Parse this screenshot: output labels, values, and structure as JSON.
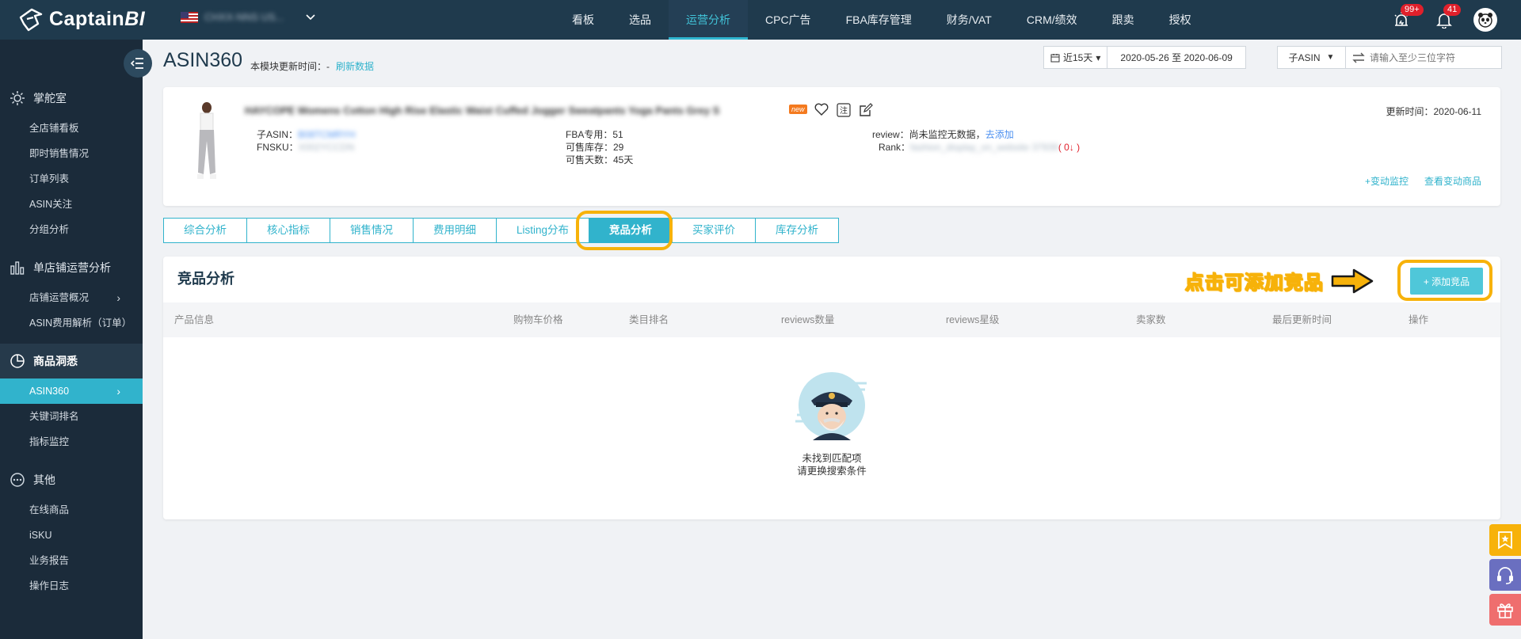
{
  "brand": {
    "name_main": "Captain",
    "name_bi": "BI"
  },
  "store": {
    "name": "CHXX-NNS US..."
  },
  "nav": [
    {
      "label": "看板",
      "active": false
    },
    {
      "label": "选品",
      "active": false
    },
    {
      "label": "运营分析",
      "active": true
    },
    {
      "label": "CPC广告",
      "active": false
    },
    {
      "label": "FBA库存管理",
      "active": false
    },
    {
      "label": "财务/VAT",
      "active": false
    },
    {
      "label": "CRM/绩效",
      "active": false
    },
    {
      "label": "跟卖",
      "active": false
    },
    {
      "label": "授权",
      "active": false
    }
  ],
  "top_icons": {
    "alert_badge": "99+",
    "notify_badge": "41"
  },
  "sidebar": {
    "groups": [
      {
        "label": "掌舵室",
        "icon": "gear-icon",
        "items": [
          "全店铺看板",
          "即时销售情况",
          "订单列表",
          "ASIN关注",
          "分组分析"
        ]
      },
      {
        "label": "单店铺运营分析",
        "icon": "bar-chart-icon",
        "items": [
          "店铺运营概况",
          "ASIN费用解析（订单）"
        ]
      },
      {
        "label": "商品洞悉",
        "icon": "pie-chart-icon",
        "items": [
          "ASIN360",
          "关键词排名",
          "指标监控"
        ]
      },
      {
        "label": "其他",
        "icon": "more-icon",
        "items": [
          "在线商品",
          "iSKU",
          "业务报告",
          "操作日志"
        ]
      }
    ]
  },
  "header": {
    "title": "ASIN360",
    "update_label": "本模块更新时间：-",
    "refresh_link": "刷新数据",
    "date_range_label": "近15天",
    "date_range_value": "2020-05-26 至 2020-06-09",
    "asin_type": "子ASIN",
    "search_placeholder": "请输入至少三位字符"
  },
  "product": {
    "title": "HAYCOPE Womens Cotton High Rise Elastic Waist Cuffed Jogger Sweatpants Yoga Pants Grey S",
    "new_tag": "new",
    "child_asin_label": "子ASIN：",
    "child_asin_value": "B08TCMRYH",
    "fnsku_label": "FNSKU：",
    "fnsku_value": "X002YCCDN",
    "fba_label": "FBA专用：51",
    "sellable_label": "可售库存：29",
    "days_label": "可售天数：45天",
    "review_label": "review：尚未监控无数据，",
    "review_link": "去添加",
    "rank_label": "Rank：",
    "rank_value": "fashion_display_on_website 37939",
    "rank_change": "( 0↓ )",
    "update_time": "更新时间：2020-06-11",
    "link_monitor": "+变动监控",
    "link_view": "查看变动商品"
  },
  "tabs": [
    {
      "label": "综合分析",
      "active": false
    },
    {
      "label": "核心指标",
      "active": false
    },
    {
      "label": "销售情况",
      "active": false
    },
    {
      "label": "费用明细",
      "active": false
    },
    {
      "label": "Listing分布",
      "active": false
    },
    {
      "label": "竞品分析",
      "active": true
    },
    {
      "label": "买家评价",
      "active": false
    },
    {
      "label": "库存分析",
      "active": false
    }
  ],
  "competitor": {
    "title": "竞品分析",
    "callout": "点击可添加竞品",
    "add_button": "+ 添加竞品",
    "columns": [
      "产品信息",
      "购物车价格",
      "类目排名",
      "reviews数量",
      "reviews星级",
      "卖家数",
      "最后更新时间",
      "操作"
    ],
    "empty_line1": "未找到匹配项",
    "empty_line2": "请更换搜索条件"
  },
  "colors": {
    "accent": "#31b3cc",
    "topbar": "#1f3a4d",
    "sidebar": "#1b2b3a",
    "highlight": "#f7b20a"
  }
}
